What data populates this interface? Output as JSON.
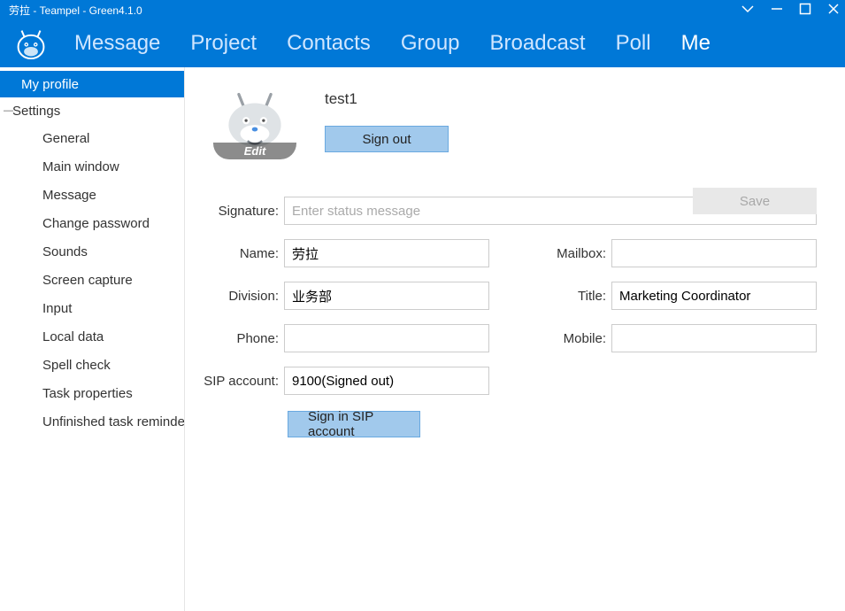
{
  "window": {
    "title": "劳拉 - Teampel - Green4.1.0"
  },
  "nav": {
    "items": [
      "Message",
      "Project",
      "Contacts",
      "Group",
      "Broadcast",
      "Poll",
      "Me"
    ],
    "activeIndex": 6
  },
  "sidebar": {
    "myprofile": "My profile",
    "settings": "Settings",
    "subs": [
      "General",
      "Main window",
      "Message",
      "Change password",
      "Sounds",
      "Screen capture",
      "Input",
      "Local data",
      "Spell check",
      "Task properties",
      "Unfinished task reminder"
    ]
  },
  "profile": {
    "username": "test1",
    "avatar_edit": "Edit",
    "signout": "Sign out",
    "save": "Save"
  },
  "form": {
    "labels": {
      "signature": "Signature:",
      "name": "Name:",
      "mailbox": "Mailbox:",
      "division": "Division:",
      "title": "Title:",
      "phone": "Phone:",
      "mobile": "Mobile:",
      "sip": "SIP account:"
    },
    "placeholders": {
      "signature": "Enter status message"
    },
    "values": {
      "name": "劳拉",
      "mailbox": "",
      "division": "业务部",
      "title": "Marketing Coordinator",
      "phone": "",
      "mobile": "",
      "sip": "9100(Signed out)"
    },
    "sip_button": "Sign in SIP account"
  }
}
